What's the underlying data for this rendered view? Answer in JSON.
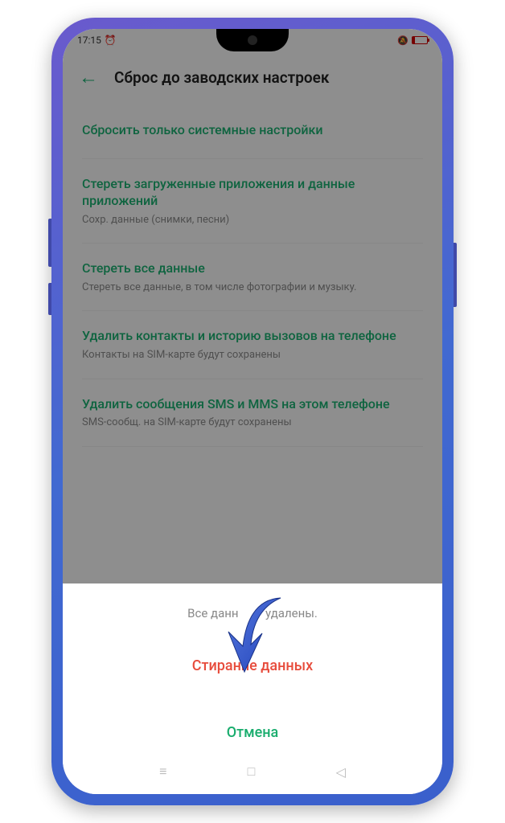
{
  "status": {
    "time": "17:15",
    "mute": "🔕"
  },
  "header": {
    "title": "Сброс до заводских настроек"
  },
  "options": [
    {
      "title": "Сбросить только системные настройки",
      "subtitle": ""
    },
    {
      "title": "Стереть загруженные приложения и данные приложений",
      "subtitle": "Сохр. данные (снимки, песни)"
    },
    {
      "title": "Стереть все данные",
      "subtitle": "Стереть все данные, в том числе фотографии и музыку."
    },
    {
      "title": "Удалить контакты и историю вызовов на телефоне",
      "subtitle": "Контакты на SIM-карте будут сохранены"
    },
    {
      "title": "Удалить сообщения SMS и MMS на этом телефоне",
      "subtitle": "SMS-сообщ. на SIM-карте будут сохранены"
    }
  ],
  "sheet": {
    "message_before": "Все данн",
    "message_after": "удалены.",
    "action": "Стирание данных",
    "cancel": "Отмена"
  },
  "colors": {
    "accent": "#1aad6e",
    "danger": "#e74c3c"
  }
}
